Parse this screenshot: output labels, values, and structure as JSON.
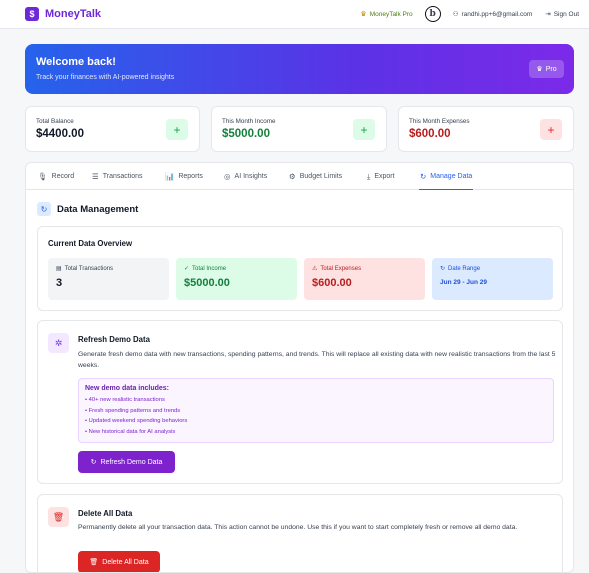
{
  "app": {
    "logo_glyph": "$",
    "name": "MoneyTalk",
    "pro_link": "MoneyTalk Pro",
    "avatar_letter": "b",
    "user_email": "randhi.pp+6@gmail.com",
    "sign_out": "Sign Out"
  },
  "banner": {
    "title": "Welcome back!",
    "subtitle": "Track your finances with AI-powered insights",
    "pro_button": "Pro"
  },
  "stats": [
    {
      "label": "Total Balance",
      "value": "$4400.00",
      "color": "#111827",
      "button": "+",
      "button_bg": "#dcfce7",
      "button_color": "#16a34a"
    },
    {
      "label": "This Month Income",
      "value": "$5000.00",
      "color": "#15803d",
      "button": "+",
      "button_bg": "#dcfce7",
      "button_color": "#16a34a"
    },
    {
      "label": "This Month Expenses",
      "value": "$600.00",
      "color": "#b91c1c",
      "button": "+",
      "button_bg": "#fee2e2",
      "button_color": "#dc2626"
    }
  ],
  "tabs": [
    {
      "label": "Record",
      "icon": "mic-icon",
      "glyph": "🎙"
    },
    {
      "label": "Transactions",
      "icon": "list-icon",
      "glyph": "☰"
    },
    {
      "label": "Reports",
      "icon": "bar-chart-icon",
      "glyph": "📊"
    },
    {
      "label": "AI Insights",
      "icon": "brain-icon",
      "glyph": "◎"
    },
    {
      "label": "Budget Limits",
      "icon": "gear-icon",
      "glyph": "⚙"
    },
    {
      "label": "Export",
      "icon": "download-icon",
      "glyph": "⤓"
    },
    {
      "label": "Manage Data",
      "icon": "refresh-icon",
      "glyph": "↻",
      "active": true
    }
  ],
  "data_management": {
    "title": "Data Management",
    "overview": {
      "title": "Current Data Overview",
      "items": [
        {
          "label": "Total Transactions",
          "value": "3",
          "bg": "#f3f4f6",
          "label_color": "#374151",
          "value_color": "#111827",
          "icon": "database-icon",
          "glyph": "▤"
        },
        {
          "label": "Total Income",
          "value": "$5000.00",
          "bg": "#dcfce7",
          "label_color": "#15803d",
          "value_color": "#15803d",
          "icon": "check-circle-icon",
          "glyph": "✓"
        },
        {
          "label": "Total Expenses",
          "value": "$600.00",
          "bg": "#fee2e2",
          "label_color": "#b91c1c",
          "value_color": "#b91c1c",
          "icon": "warning-icon",
          "glyph": "⚠"
        },
        {
          "label": "Date Range",
          "value": "Jun 29 - Jun 29",
          "bg": "#dbeafe",
          "label_color": "#1d4ed8",
          "value_color": "#1d4ed8",
          "icon": "refresh-icon",
          "glyph": "↻",
          "small": true
        }
      ]
    },
    "refresh": {
      "title": "Refresh Demo Data",
      "description": "Generate fresh demo data with new transactions, spending patterns, and trends. This will replace all existing data with new realistic transactions from the last 5 weeks.",
      "includes_title": "New demo data includes:",
      "includes": [
        "• 40+ new realistic transactions",
        "• Fresh spending patterns and trends",
        "• Updated weekend spending behaviors",
        "• New historical data for AI analysis"
      ],
      "button": "Refresh Demo Data"
    },
    "delete": {
      "title": "Delete All Data",
      "description": "Permanently delete all your transaction data. This action cannot be undone. Use this if you want to start completely fresh or remove all demo data.",
      "button": "Delete All Data"
    }
  }
}
